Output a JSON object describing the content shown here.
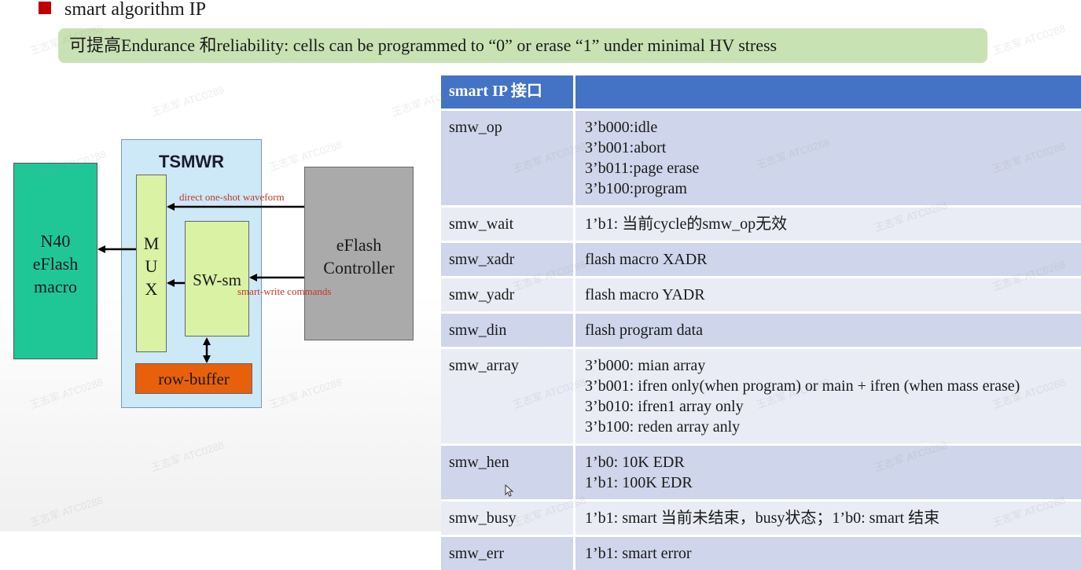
{
  "slide": {
    "title": "smart algorithm IP",
    "banner": "可提高Endurance 和reliability: cells can be programmed to “0” or erase “1” under minimal HV stress"
  },
  "diagram": {
    "n40_label": "N40\neFlash\nmacro",
    "tsmwr_label": "TSMWR",
    "mux_label": "M\nU\nX",
    "swsm_label": "SW-sm",
    "rowbuffer_label": "row-buffer",
    "controller_label": "eFlash\nController",
    "direct_label": "direct one-shot waveform",
    "smart_label": "smart-write commands"
  },
  "table": {
    "header": [
      "smart IP 接口",
      ""
    ],
    "rows": [
      {
        "name": "smw_op",
        "desc": "3’b000:idle\n3’b001:abort\n3’b011:page erase\n3’b100:program"
      },
      {
        "name": "smw_wait",
        "desc": "1’b1: 当前cycle的smw_op无效"
      },
      {
        "name": "smw_xadr",
        "desc": "flash macro XADR"
      },
      {
        "name": "smw_yadr",
        "desc": "flash macro YADR"
      },
      {
        "name": "smw_din",
        "desc": "flash program data"
      },
      {
        "name": "smw_array",
        "desc": "3’b000: mian array\n3’b001: ifren only(when program) or main + ifren (when mass erase)\n3’b010: ifren1 array only\n3’b100: reden array anly"
      },
      {
        "name": "smw_hen",
        "desc": "1’b0: 10K EDR\n1’b1: 100K EDR"
      },
      {
        "name": "smw_busy",
        "desc": "1’b1: smart 当前未结束，busy状态；1’b0: smart 结束"
      },
      {
        "name": "smw_err",
        "desc": "1’b1: smart error"
      }
    ]
  },
  "watermark": "王志军 ATC0288",
  "colors": {
    "bullet": "#c00000",
    "banner_bg": "#c9e2b3",
    "table_header": "#4472c4",
    "row_odd": "#cfd5ea",
    "row_even": "#e9ebf5",
    "n40": "#1fc797",
    "tsmwr": "#cde8f7",
    "mux": "#d9f2a4",
    "row_buffer": "#e8600c",
    "controller": "#aaaaaa",
    "arrow_label": "#c0392b"
  }
}
